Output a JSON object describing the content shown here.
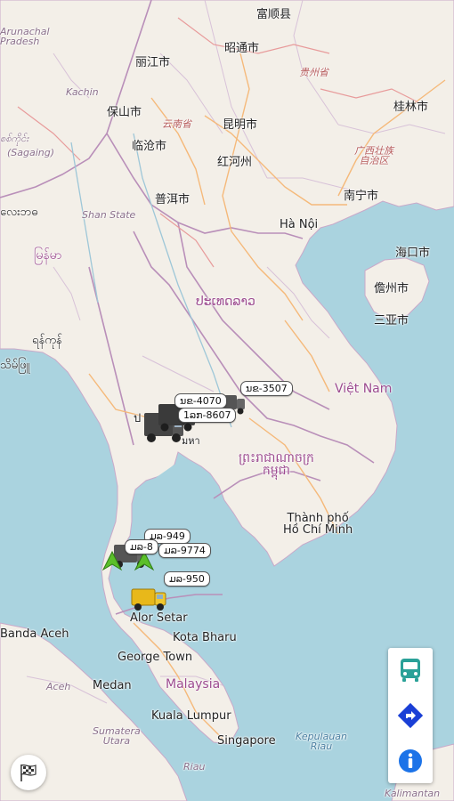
{
  "map": {
    "labels": {
      "fumin": "富顺县",
      "zhaotong": "昭通市",
      "lijiang": "丽江市",
      "guizhou": "贵州省",
      "baoshan": "保山市",
      "yunnan": "云南省",
      "kunming": "昆明市",
      "guilin": "桂林市",
      "lincang": "临沧市",
      "honghe": "红河州",
      "guangxi": "广西壮族\n自治区",
      "puer": "普洱市",
      "nanning": "南宁市",
      "hanoi": "Hà Nội",
      "haikou": "海口市",
      "danzhou": "儋州市",
      "sanya": "三亚市",
      "laos": "ປະເທດລາວ",
      "vietnam": "Việt Nam",
      "cambodia": "ព្រះរាជាណាចក្រ\nកម្ពុជា",
      "hcm": "Thành phố\nHồ Chí Minh",
      "kachin": "Kachin",
      "shan": "Shan State",
      "arunachal": "Arunachal\nPradesh",
      "sagaing": "(Sagaing)",
      "sagaing_my": "စစ်ကိုင်း",
      "myanmar1": "လေးဘဓ",
      "myanmar2": "မြန်မာ",
      "myanmar3": "ရန်ကုန်",
      "myanmar4": "သိမ်ဖြူ",
      "bangkok_part": "ป",
      "bangkok_part2": "มหา",
      "alorsetar": "Alor Setar",
      "kotabharu": "Kota Bharu",
      "banda": "Banda Aceh",
      "georgetown": "George Town",
      "aceh": "Aceh",
      "medan": "Medan",
      "malaysia": "Malaysia",
      "kl": "Kuala Lumpur",
      "sumatera": "Sumatera\nUtara",
      "singapore": "Singapore",
      "kepulauan": "Kepulauan\nRiau",
      "riau": "Riau",
      "kalimantan": "Kalimantan"
    },
    "vehicle_tags": {
      "t1": "ນຂ-3507",
      "t2": "ນຂ-4070",
      "t3": "1ລກ-8607",
      "t4": "ມລ-949",
      "t5": "ມລ-8",
      "t6": "ມລ-9774",
      "t7": "ມລ-950"
    }
  },
  "controls": {
    "bus_icon": "bus-icon",
    "directions_icon": "directions-icon",
    "info_icon": "info-icon",
    "flag_icon": "checkered-flag-icon",
    "accent": "#2aa198",
    "directions_color": "#1a3fd6",
    "info_color": "#1c73e8"
  }
}
